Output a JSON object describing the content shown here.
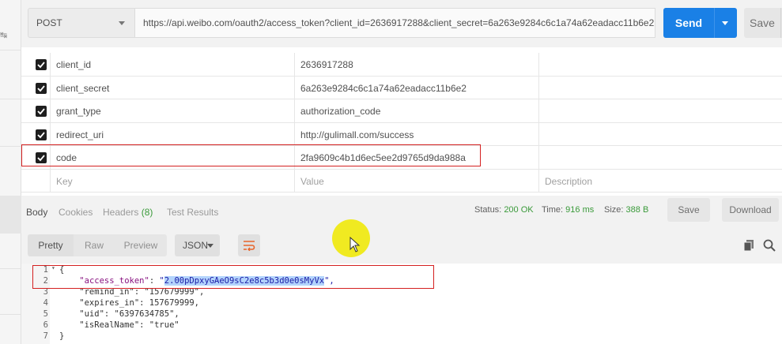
{
  "request": {
    "method": "POST",
    "url": "https://api.weibo.com/oauth2/access_token?client_id=2636917288&client_secret=6a263e9284c6c1a74a62eadacc11b6e2...",
    "send_label": "Send",
    "save_label": "Save"
  },
  "params": [
    {
      "key": "client_id",
      "value": "2636917288",
      "checked": true
    },
    {
      "key": "client_secret",
      "value": "6a263e9284c6c1a74a62eadacc11b6e2",
      "checked": true
    },
    {
      "key": "grant_type",
      "value": "authorization_code",
      "checked": true
    },
    {
      "key": "redirect_uri",
      "value": "http://gulimall.com/success",
      "checked": true
    },
    {
      "key": "code",
      "value": "2fa9609c4b1d6ec5ee2d9765d9da988a",
      "checked": true
    }
  ],
  "params_placeholder": {
    "key": "Key",
    "value": "Value",
    "description": "Description"
  },
  "response": {
    "tabs": [
      "Body",
      "Cookies",
      "Headers",
      "Test Results"
    ],
    "headers_count": "(8)",
    "status_label": "Status:",
    "status_value": "200 OK",
    "time_label": "Time:",
    "time_value": "916 ms",
    "size_label": "Size:",
    "size_value": "388 B",
    "save_label": "Save",
    "download_label": "Download",
    "view_modes": [
      "Pretty",
      "Raw",
      "Preview"
    ],
    "format": "JSON"
  },
  "body_lines": [
    {
      "n": "1",
      "text": "{"
    },
    {
      "n": "2",
      "text": "    \"access_token\": \"2.00pDpxyGAeO9sC2e8c5b3d0e0sMyVx\","
    },
    {
      "n": "3",
      "text": "    \"remind_in\": \"157679999\","
    },
    {
      "n": "4",
      "text": "    \"expires_in\": 157679999,"
    },
    {
      "n": "5",
      "text": "    \"uid\": \"6397634785\","
    },
    {
      "n": "6",
      "text": "    \"isRealName\": \"true\""
    },
    {
      "n": "7",
      "text": "}"
    }
  ],
  "colors": {
    "accent": "#1a80e6",
    "status_ok": "#3a9a3a",
    "highlight_box": "#d42020"
  }
}
